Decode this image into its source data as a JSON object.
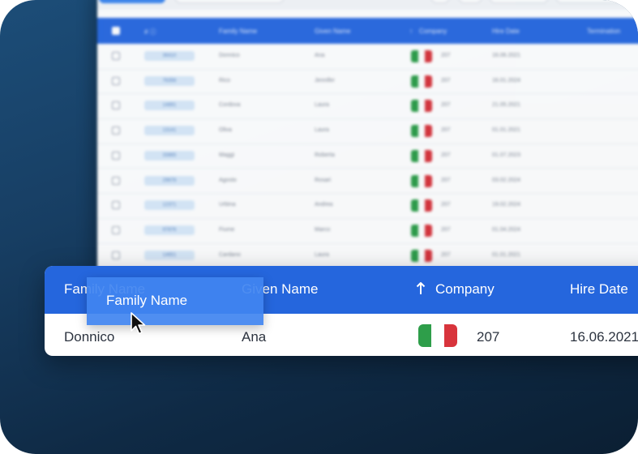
{
  "background_grid": {
    "columns": {
      "id_label": "# ⓘ",
      "family_name": "Family Name",
      "given_name": "Given Name",
      "company": "Company",
      "hire_date": "Hire Date",
      "termination": "Termination"
    },
    "rows": [
      {
        "id": "36410",
        "family": "Donnico",
        "given": "Ana",
        "company": "207",
        "date": "16.06.2021"
      },
      {
        "id": "76356",
        "family": "Rico",
        "given": "Jennifer",
        "company": "207",
        "date": "16.01.2024"
      },
      {
        "id": "14891",
        "family": "Cordova",
        "given": "Laura",
        "company": "207",
        "date": "21.05.2021"
      },
      {
        "id": "13141",
        "family": "Oliva",
        "given": "Laura",
        "company": "207",
        "date": "01.01.2021"
      },
      {
        "id": "33865",
        "family": "Maggi",
        "given": "Roberta",
        "company": "207",
        "date": "01.07.2023"
      },
      {
        "id": "29678",
        "family": "Agosto",
        "given": "Rosari",
        "company": "207",
        "date": "03.02.2024"
      },
      {
        "id": "12371",
        "family": "Urbina",
        "given": "Andrea",
        "company": "207",
        "date": "19.02.2024"
      },
      {
        "id": "97876",
        "family": "Fiume",
        "given": "Marco",
        "company": "207",
        "date": "01.04.2024"
      },
      {
        "id": "14651",
        "family": "Cardano",
        "given": "Laura",
        "company": "207",
        "date": "01.01.2021"
      }
    ]
  },
  "highlight": {
    "headers": {
      "family_name": "Family Name",
      "given_name": "Given Name",
      "company": "Company",
      "hire_date": "Hire Date"
    },
    "row": {
      "family": "Donnico",
      "given": "Ana",
      "company": "207",
      "hire_date": "16.06.2021"
    }
  },
  "drag_ghost": {
    "label": "Family Name"
  },
  "flag_colors": [
    "#2e9e4a",
    "#ffffff",
    "#d8343c"
  ]
}
